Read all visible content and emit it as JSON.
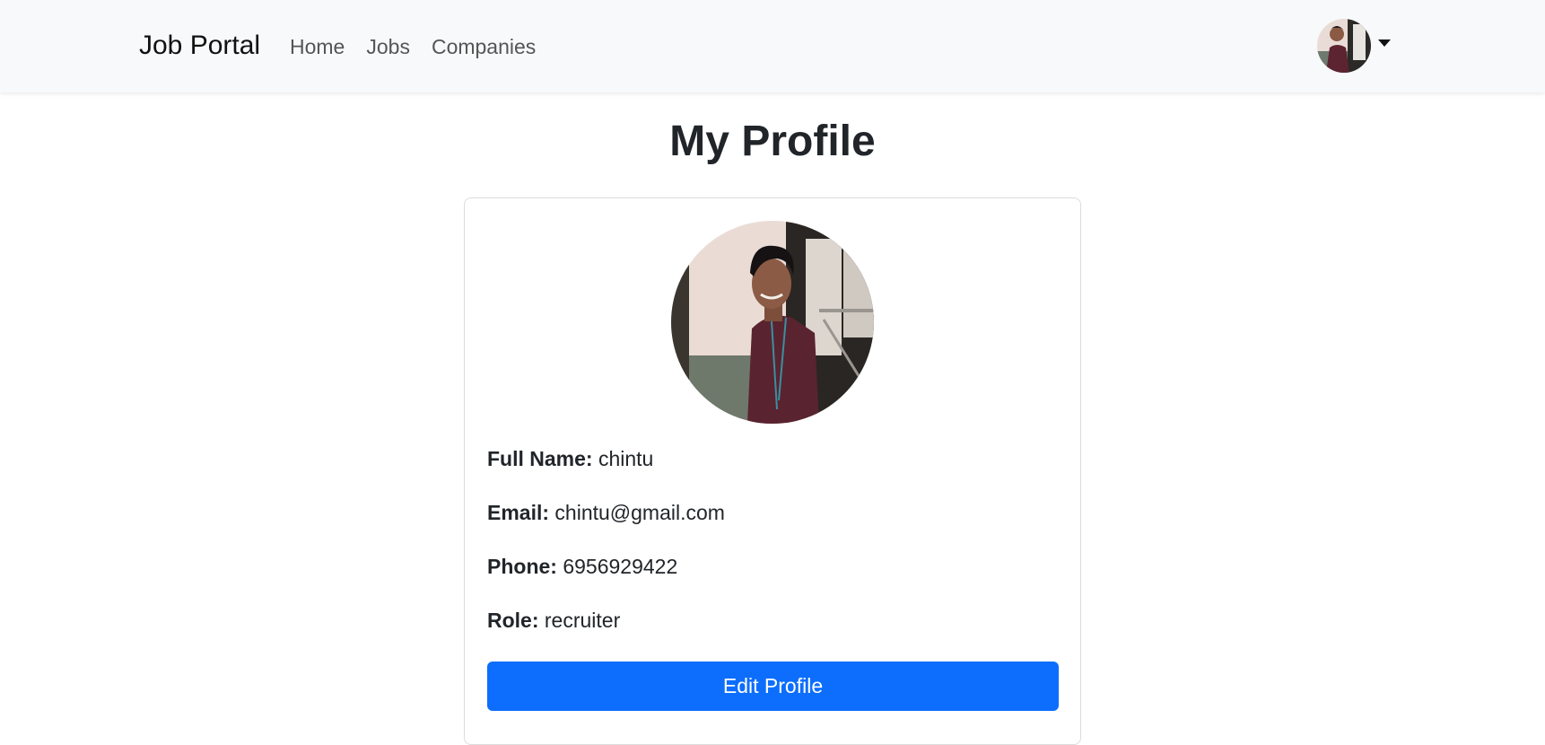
{
  "navbar": {
    "brand": "Job Portal",
    "links": [
      {
        "label": "Home"
      },
      {
        "label": "Jobs"
      },
      {
        "label": "Companies"
      }
    ],
    "avatar_icon": "user-avatar-photo",
    "dropdown_icon": "caret-down-icon"
  },
  "page": {
    "title": "My Profile"
  },
  "profile": {
    "photo_icon": "profile-photo",
    "fields": [
      {
        "label": "Full Name:",
        "value": "chintu"
      },
      {
        "label": "Email:",
        "value": "chintu@gmail.com"
      },
      {
        "label": "Phone:",
        "value": "6956929422"
      },
      {
        "label": "Role:",
        "value": "recruiter"
      }
    ],
    "edit_button": "Edit Profile"
  },
  "colors": {
    "primary": "#0d6efd",
    "navbar_bg": "#f8f9fa",
    "text": "#212529"
  }
}
